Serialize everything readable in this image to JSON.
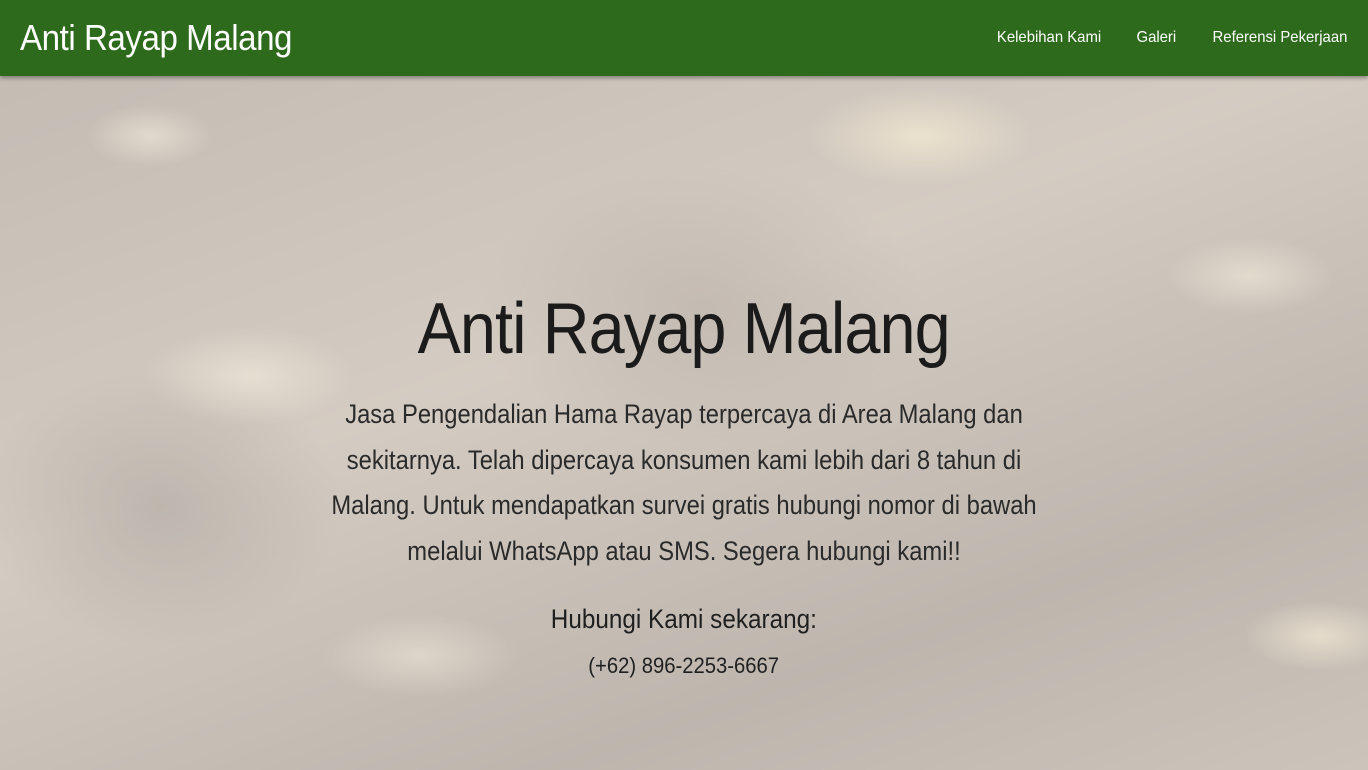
{
  "navbar": {
    "brand": "Anti Rayap Malang",
    "links": [
      "Kelebihan Kami",
      "Galeri",
      "Referensi Pekerjaan"
    ],
    "background_color": "#2d6a1c"
  },
  "hero": {
    "title": "Anti Rayap Malang",
    "description": "Jasa Pengendalian Hama Rayap terpercaya di Area Malang dan sekitarnya. Telah dipercaya konsumen kami lebih dari 8 tahun di Malang. Untuk mendapatkan survei gratis hubungi nomor di bawah melalui WhatsApp atau SMS. Segera hubungi kami!!",
    "contact_heading": "Hubungi Kami sekarang:",
    "phone": "(+62) 896-2253-6667"
  }
}
